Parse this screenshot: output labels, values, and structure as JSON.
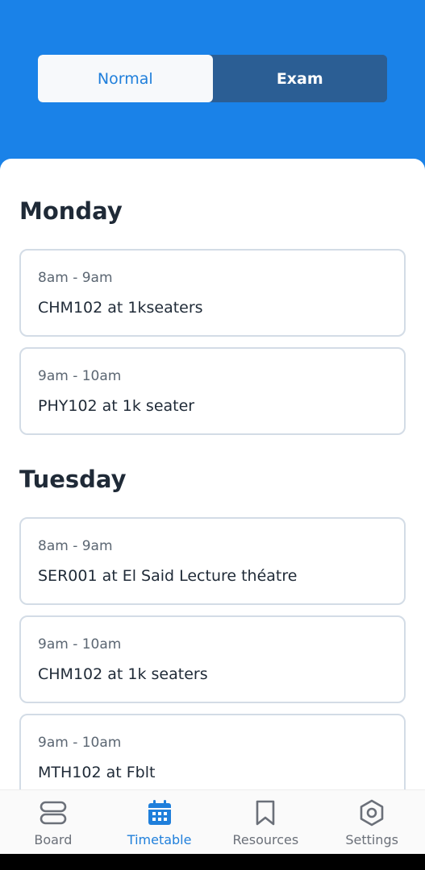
{
  "tabs": {
    "normal": "Normal",
    "exam": "Exam"
  },
  "days": [
    {
      "name": "Monday",
      "classes": [
        {
          "time": "8am - 9am",
          "title": "CHM102 at 1kseaters"
        },
        {
          "time": "9am - 10am",
          "title": "PHY102 at 1k seater"
        }
      ]
    },
    {
      "name": "Tuesday",
      "classes": [
        {
          "time": "8am - 9am",
          "title": "SER001 at El Said Lecture théatre"
        },
        {
          "time": "9am - 10am",
          "title": "CHM102 at 1k seaters"
        },
        {
          "time": "9am - 10am",
          "title": "MTH102 at Fblt"
        }
      ]
    }
  ],
  "nav": {
    "board": "Board",
    "timetable": "Timetable",
    "resources": "Resources",
    "settings": "Settings",
    "active": "timetable",
    "icons": [
      "board-icon",
      "calendar-icon",
      "bookmark-icon",
      "settings-hex-icon"
    ]
  },
  "colors": {
    "primary": "#1a82e8",
    "segment_inactive": "#2b5e94",
    "active_text": "#1f7fdb",
    "card_border": "#d3dce6"
  }
}
